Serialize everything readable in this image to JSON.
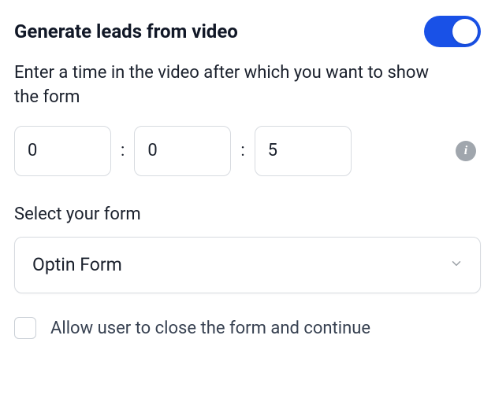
{
  "header": {
    "title": "Generate leads from video",
    "toggle_on": true
  },
  "subtitle": "Enter a time in the video after which you want to show the form",
  "time": {
    "hours": "0",
    "minutes": "0",
    "seconds": "5",
    "separator": ":"
  },
  "info_icon": "i",
  "form_select": {
    "label": "Select your form",
    "selected": "Optin Form"
  },
  "allow_close": {
    "checked": false,
    "label": "Allow user to close the form and continue"
  }
}
